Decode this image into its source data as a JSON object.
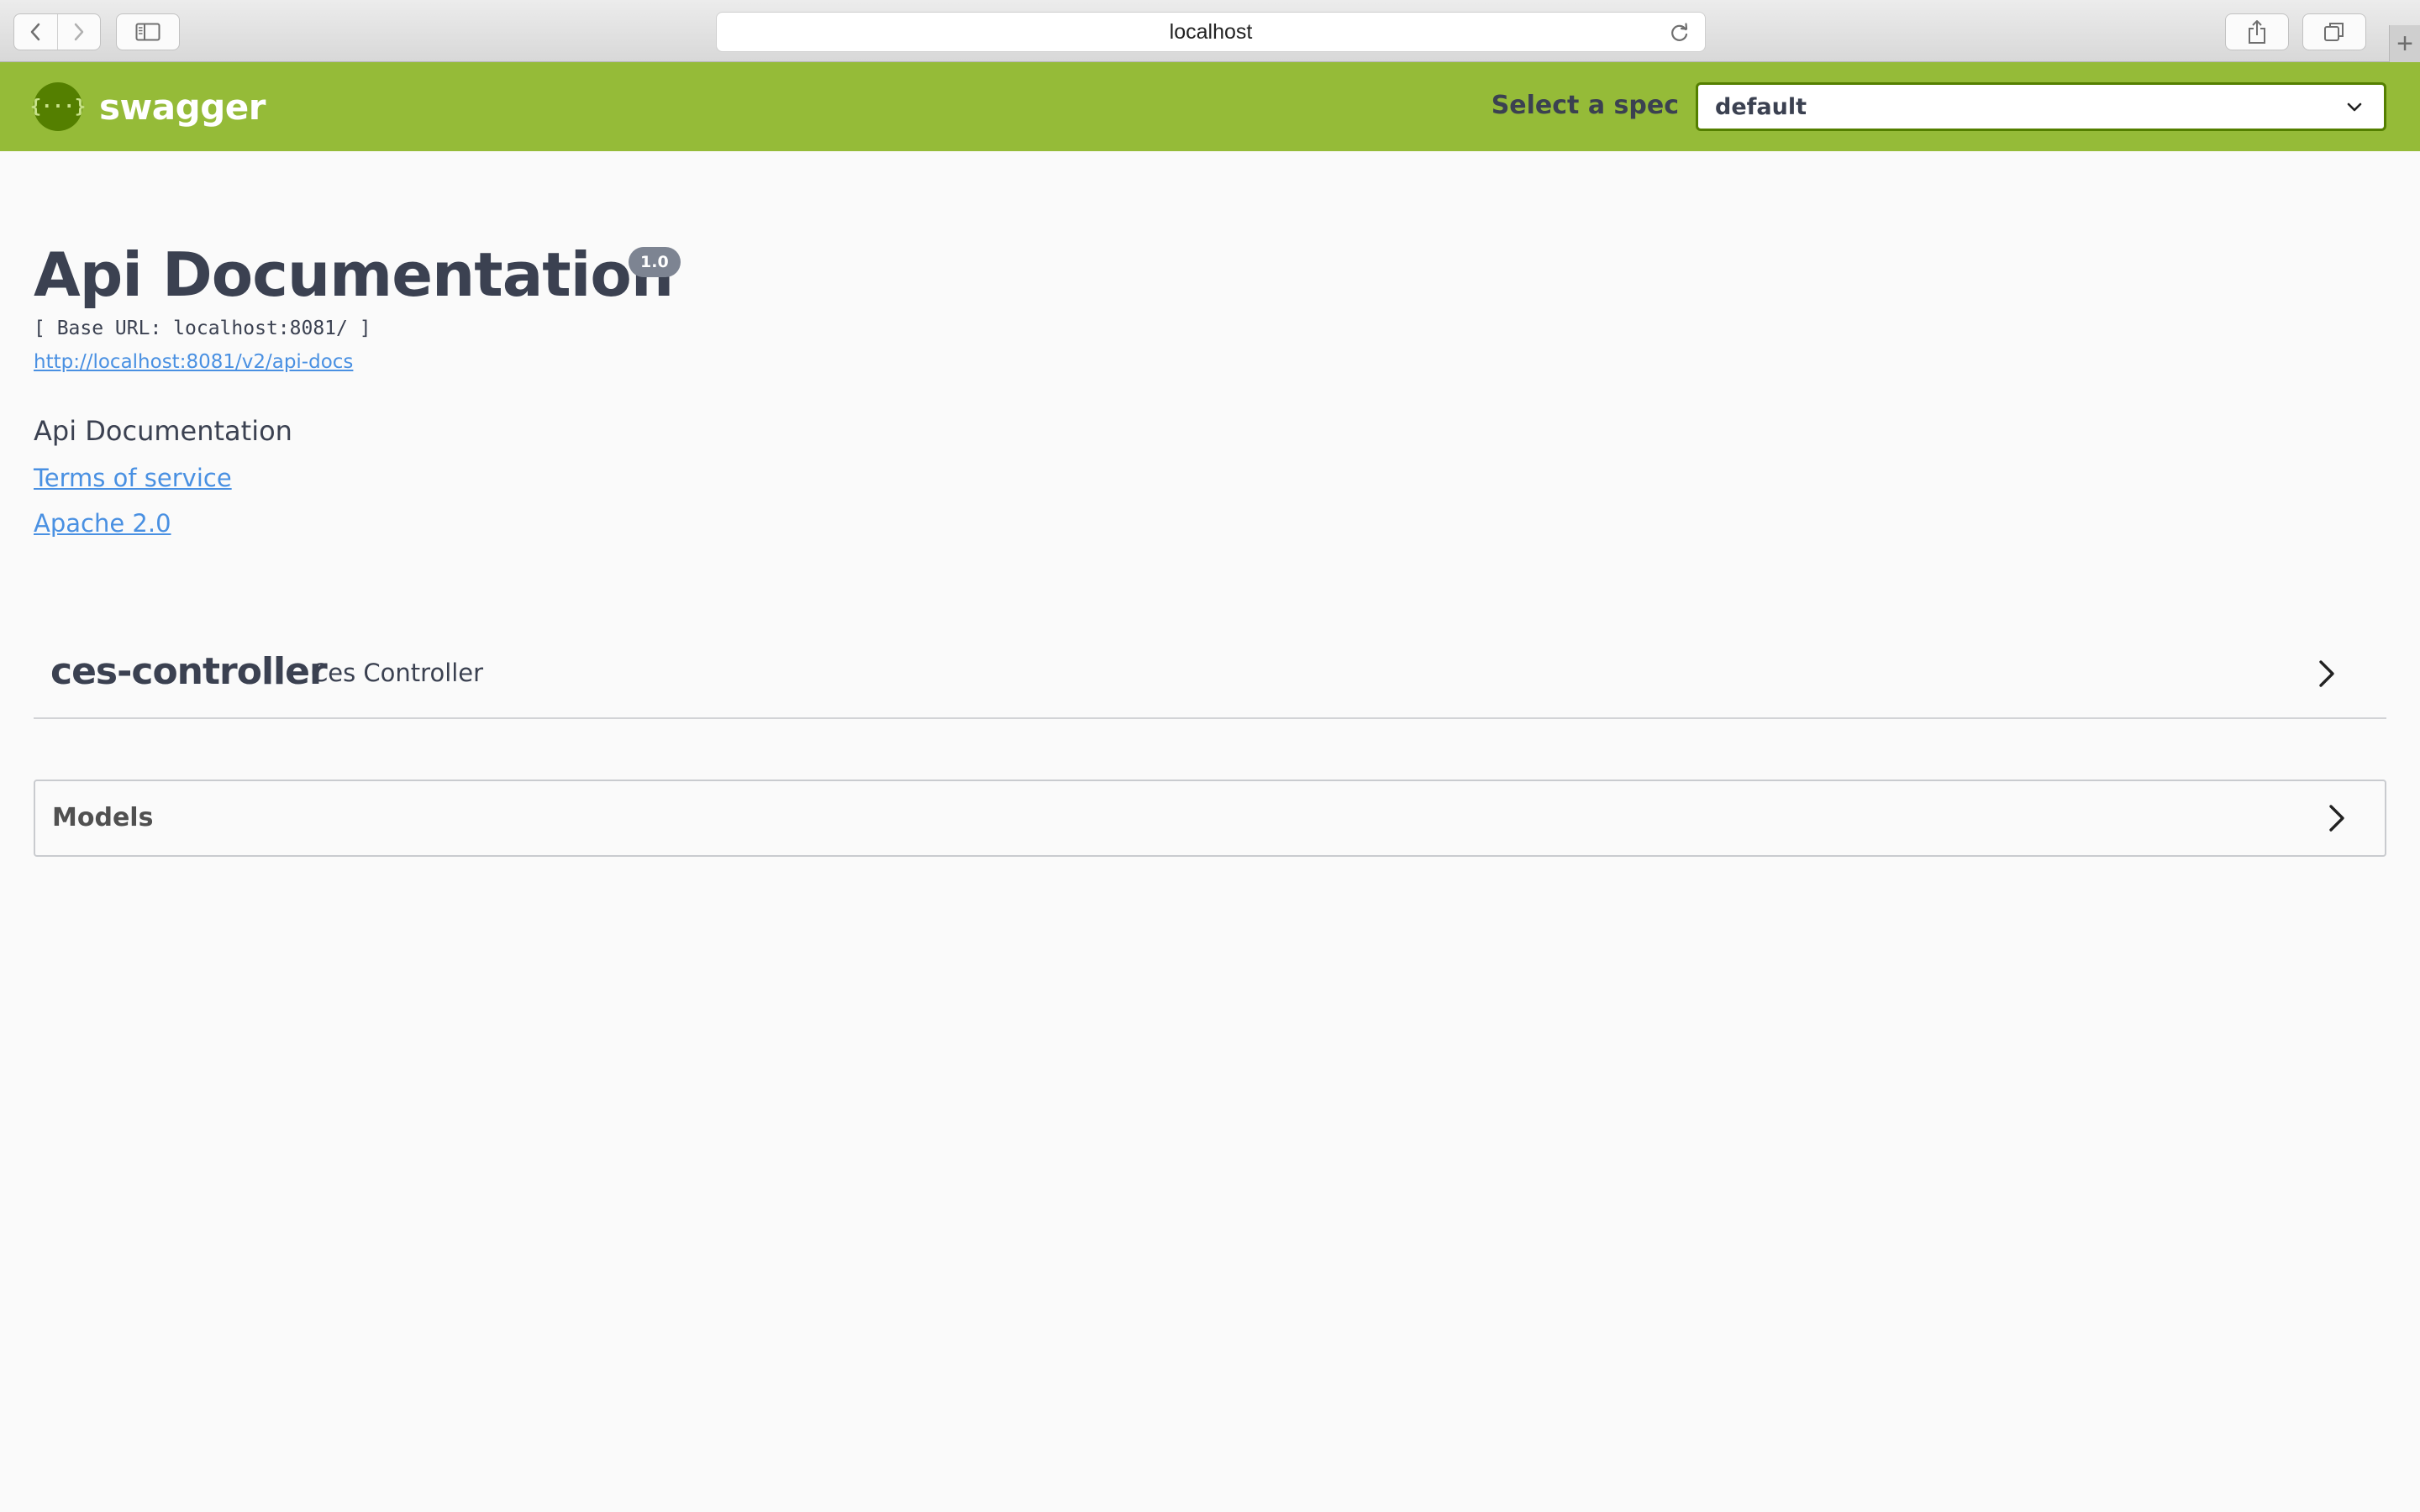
{
  "browser": {
    "address": "localhost",
    "icons": {
      "back": "chevron-left-icon",
      "forward": "chevron-right-icon",
      "sidebar": "sidebar-icon",
      "reload": "reload-icon",
      "share": "share-icon",
      "tabs": "tabs-icon",
      "new_tab": "plus-icon"
    },
    "new_tab_glyph": "+"
  },
  "topbar": {
    "brand": "swagger",
    "logo_glyph": "{···}",
    "spec_label": "Select a spec",
    "spec_value": "default",
    "bg_color": "#95bb38",
    "accent_color": "#547f00"
  },
  "info": {
    "title": "Api Documentation",
    "version": "1.0",
    "base_url": "[ Base URL: localhost:8081/ ]",
    "api_docs_link": "http://localhost:8081/v2/api-docs",
    "description": "Api Documentation",
    "terms_of_service": "Terms of service",
    "license": "Apache 2.0",
    "link_color": "#4990e2"
  },
  "tags": [
    {
      "name": "ces-controller",
      "description": "Ces Controller"
    }
  ],
  "models": {
    "title": "Models"
  }
}
